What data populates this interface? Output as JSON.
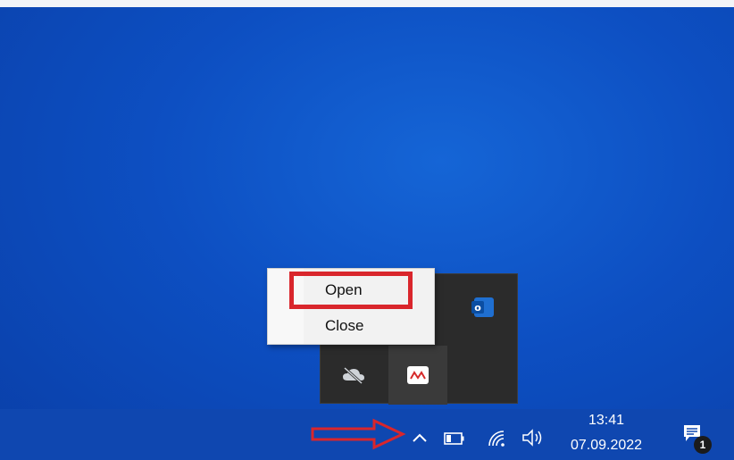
{
  "context_menu": {
    "items": [
      {
        "label": "Open"
      },
      {
        "label": "Close"
      }
    ]
  },
  "tray_flyout": {
    "icons": [
      "outlook-icon",
      "onedrive-offline-icon",
      "monitoring-app-icon"
    ]
  },
  "taskbar": {
    "clock": {
      "time": "13:41",
      "date": "07.09.2022"
    },
    "notification_count": "1",
    "icons": [
      "show-hidden-icons-chevron",
      "battery-icon",
      "network-icon",
      "volume-icon",
      "action-center-icon"
    ]
  },
  "colors": {
    "desktop_blue": "#0d4fc2",
    "annotation_red": "#d9262c",
    "flyout_bg": "#2b2b2b"
  }
}
